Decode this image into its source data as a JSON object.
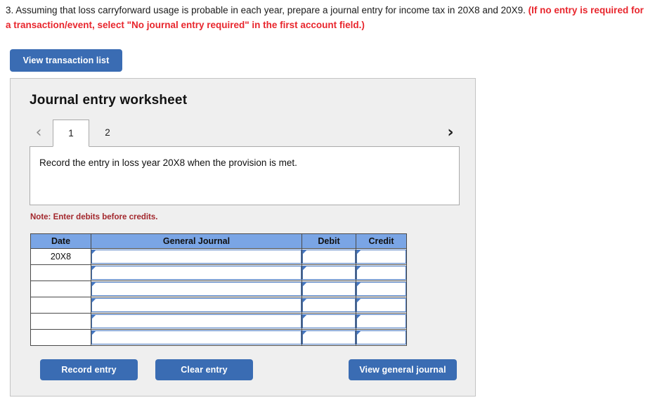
{
  "question": {
    "main": "3. Assuming that loss carryforward usage is probable in each year, prepare a journal entry for income tax in 20X8 and 20X9. ",
    "emphasis": "(If no entry is required for a transaction/event, select \"No journal entry required\" in the first account field.)"
  },
  "toolbar": {
    "view_transaction_list_label": "View transaction list"
  },
  "panel": {
    "title": "Journal entry worksheet",
    "nav": {
      "prev_icon": "chevron-left-icon",
      "next_icon": "chevron-right-icon",
      "prev_glyph": "‹",
      "next_glyph": "›"
    },
    "tabs": [
      {
        "label": "1",
        "active": true
      },
      {
        "label": "2",
        "active": false
      }
    ],
    "instruction": "Record the entry in loss year 20X8 when the provision is met.",
    "note": "Note: Enter debits before credits."
  },
  "table": {
    "headers": [
      "Date",
      "General Journal",
      "Debit",
      "Credit"
    ],
    "rows": [
      {
        "date": "20X8",
        "general_journal": "",
        "debit": "",
        "credit": ""
      },
      {
        "date": "",
        "general_journal": "",
        "debit": "",
        "credit": ""
      },
      {
        "date": "",
        "general_journal": "",
        "debit": "",
        "credit": ""
      },
      {
        "date": "",
        "general_journal": "",
        "debit": "",
        "credit": ""
      },
      {
        "date": "",
        "general_journal": "",
        "debit": "",
        "credit": ""
      },
      {
        "date": "",
        "general_journal": "",
        "debit": "",
        "credit": ""
      }
    ]
  },
  "footer": {
    "record_entry_label": "Record entry",
    "clear_entry_label": "Clear entry",
    "view_general_journal_label": "View general journal"
  },
  "colors": {
    "button_blue": "#3a6cb3",
    "header_blue": "#7aa5e5",
    "field_border_blue": "#4677c0",
    "note_red": "#a3282d",
    "emphasis_red": "#e8262d",
    "panel_gray": "#efefef"
  }
}
